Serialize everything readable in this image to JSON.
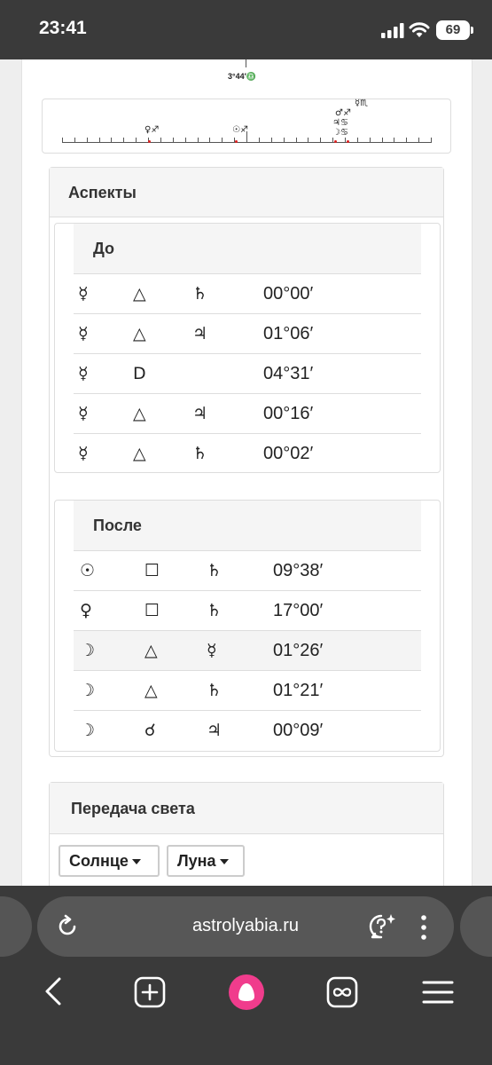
{
  "status_bar": {
    "time": "23:41",
    "battery": "69"
  },
  "chart_strip": {
    "top_degree_label": "3°44′♎",
    "planet_markers": [
      {
        "glyphs": "♀♐"
      },
      {
        "glyphs": "☉♐"
      },
      {
        "glyphs": "☿♏"
      },
      {
        "glyphs": "♂♐"
      },
      {
        "glyphs": "♃♋"
      },
      {
        "glyphs": "☽♋"
      }
    ]
  },
  "aspects": {
    "title": "Аспекты",
    "before": {
      "title": "До",
      "rows": [
        {
          "p1": "☿",
          "aspect": "△",
          "p2": "♄",
          "orb": "00°00′"
        },
        {
          "p1": "☿",
          "aspect": "△",
          "p2": "♃",
          "orb": "01°06′"
        },
        {
          "p1": "☿",
          "aspect": "D",
          "p2": "",
          "orb": "04°31′"
        },
        {
          "p1": "☿",
          "aspect": "△",
          "p2": "♃",
          "orb": "00°16′"
        },
        {
          "p1": "☿",
          "aspect": "△",
          "p2": "♄",
          "orb": "00°02′"
        }
      ]
    },
    "after": {
      "title": "После",
      "rows": [
        {
          "p1": "☉",
          "aspect": "☐",
          "p2": "♄",
          "orb": "09°38′"
        },
        {
          "p1": "♀",
          "aspect": "☐",
          "p2": "♄",
          "orb": "17°00′"
        },
        {
          "p1": "☽",
          "aspect": "△",
          "p2": "☿",
          "orb": "01°26′"
        },
        {
          "p1": "☽",
          "aspect": "△",
          "p2": "♄",
          "orb": "01°21′"
        },
        {
          "p1": "☽",
          "aspect": "☌",
          "p2": "♃",
          "orb": "00°09′"
        }
      ]
    }
  },
  "light_transfer": {
    "title": "Передача света",
    "select1": "Солнце",
    "select2": "Луна"
  },
  "browser": {
    "url": "astrolyabia.ru"
  }
}
